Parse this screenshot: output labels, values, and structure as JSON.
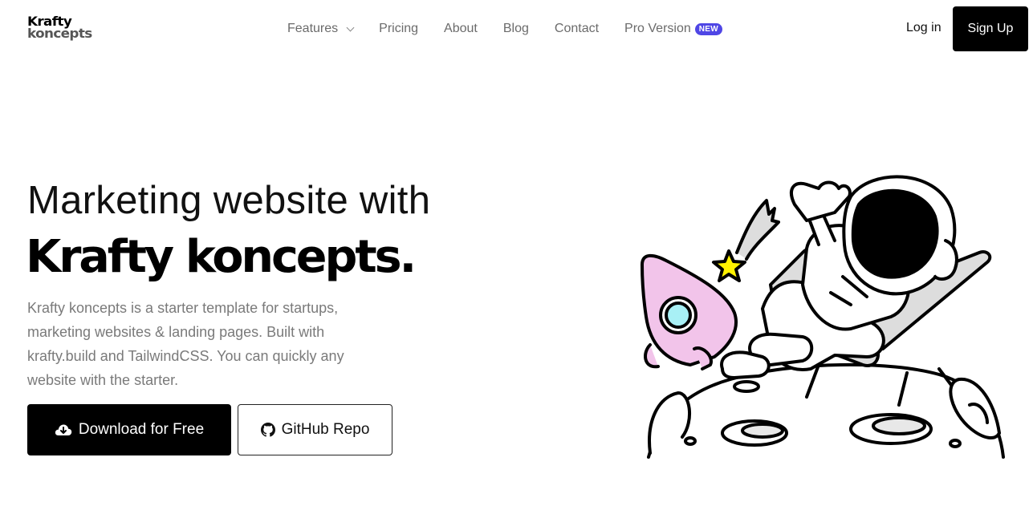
{
  "brand": {
    "line1": "Krafty",
    "line2": "koncepts"
  },
  "nav": {
    "items": [
      {
        "label": "Features",
        "has_dropdown": true
      },
      {
        "label": "Pricing"
      },
      {
        "label": "About"
      },
      {
        "label": "Blog"
      },
      {
        "label": "Contact"
      },
      {
        "label": "Pro Version",
        "badge": "NEW"
      }
    ],
    "login_label": "Log in",
    "signup_label": "Sign Up"
  },
  "hero": {
    "headline_line1": "Marketing website with",
    "headline_line2": "Krafty koncepts.",
    "description": "Krafty koncepts is a starter template for startups, marketing websites & landing pages. Built with krafty.build and TailwindCSS. You can quickly any website with the starter.",
    "primary_button": "Download for Free",
    "secondary_button": "GitHub Repo"
  },
  "icons": {
    "primary_button_icon": "cloud-download-icon",
    "secondary_button_icon": "github-icon",
    "features_dropdown_icon": "chevron-down-icon",
    "illustration": "astronaut-illustration"
  },
  "colors": {
    "badge": "#4f46e5",
    "primary_button": "#000000",
    "rocket": "#f2c4ea",
    "star": "#fff200",
    "window": "#a8f0f5"
  }
}
